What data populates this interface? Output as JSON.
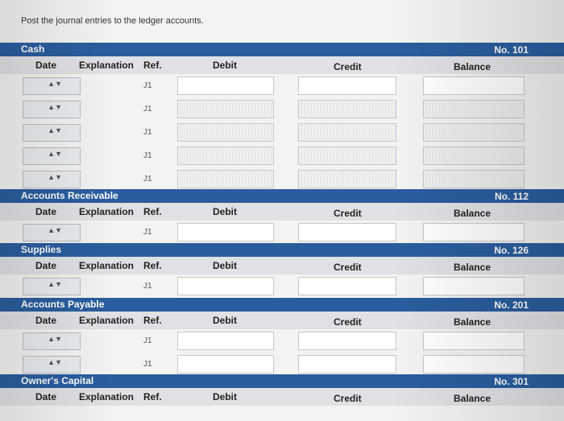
{
  "instruction": "Post the journal entries to the ledger accounts.",
  "columns": {
    "date": "Date",
    "explanation": "Explanation",
    "ref": "Ref.",
    "debit": "Debit",
    "credit": "Credit",
    "balance": "Balance"
  },
  "accounts": [
    {
      "name": "Cash",
      "number": "No. 101",
      "refs": [
        "J1",
        "J1",
        "J1",
        "J1",
        "J1"
      ]
    },
    {
      "name": "Accounts Receivable",
      "number": "No. 112",
      "refs": [
        "J1"
      ]
    },
    {
      "name": "Supplies",
      "number": "No. 126",
      "refs": [
        "J1"
      ]
    },
    {
      "name": "Accounts Payable",
      "number": "No. 201",
      "refs": [
        "J1",
        "J1"
      ]
    },
    {
      "name": "Owner's Capital",
      "number": "No. 301",
      "refs": []
    }
  ],
  "stepper_glyph": "▲▼"
}
